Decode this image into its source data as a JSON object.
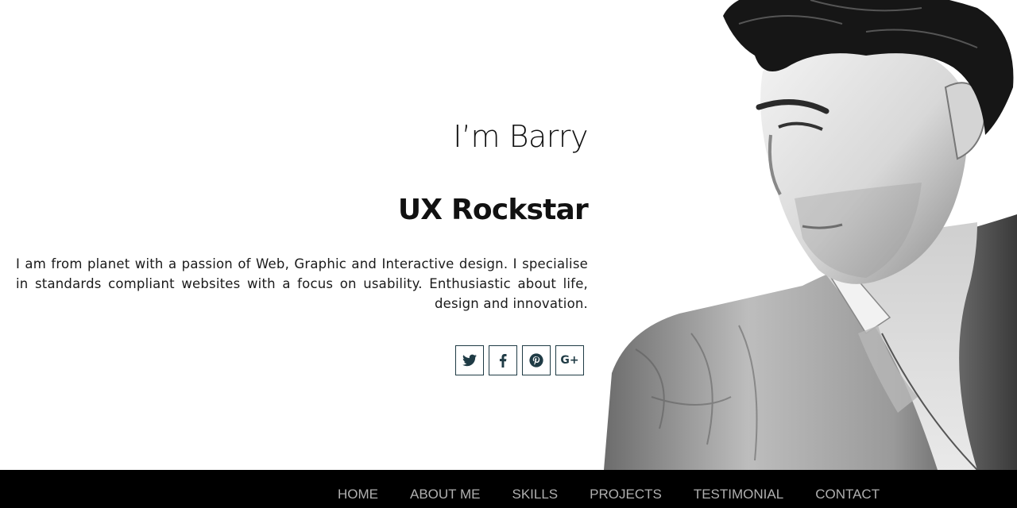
{
  "hero": {
    "greeting": "I’m Barry",
    "role": "UX Rockstar",
    "bio": "I am from planet with a passion of Web, Graphic and Interactive design. I specialise in standards compliant websites with a focus on usability. Enthusiastic about life, design and innovation.",
    "social": [
      {
        "name": "twitter-icon"
      },
      {
        "name": "facebook-icon"
      },
      {
        "name": "pinterest-icon"
      },
      {
        "name": "google-plus-icon",
        "label": "G+"
      }
    ]
  },
  "nav": {
    "items": [
      "HOME",
      "ABOUT ME",
      "SKILLS",
      "PROJECTS",
      "TESTIMONIAL",
      "CONTACT"
    ]
  },
  "colors": {
    "icon": "#1f3b45",
    "nav_bg": "#000000",
    "nav_text": "#b0b0b0"
  }
}
